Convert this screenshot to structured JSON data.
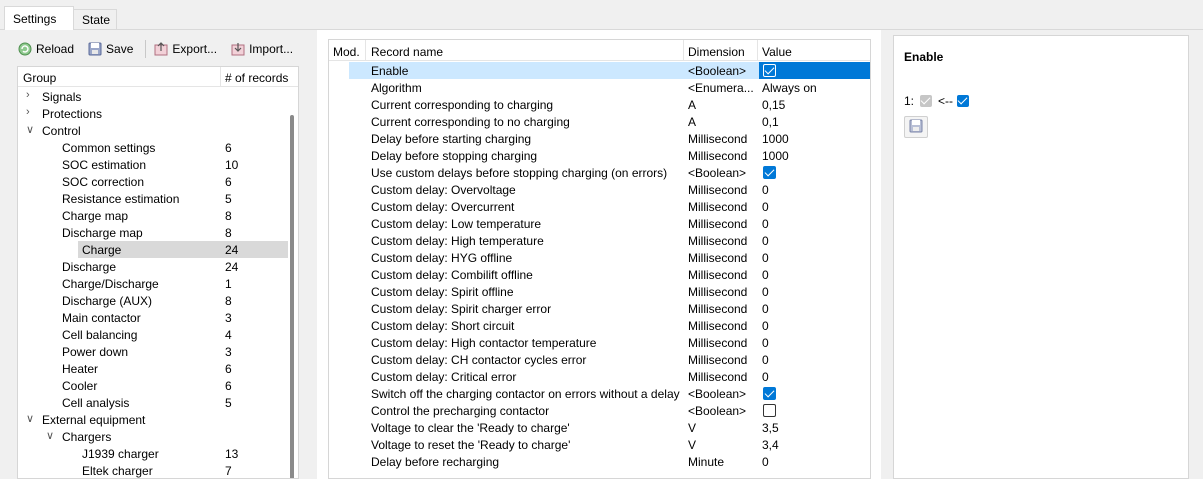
{
  "tabs": [
    {
      "label": "Settings"
    },
    {
      "label": "State"
    }
  ],
  "toolbar": {
    "reload": "Reload",
    "save": "Save",
    "export": "Export...",
    "import": "Import..."
  },
  "tree": {
    "headers": {
      "group": "Group",
      "count": "# of records"
    },
    "items": [
      {
        "label": "Signals",
        "count": "",
        "level": 0,
        "arrow": "collapsed"
      },
      {
        "label": "Protections",
        "count": "",
        "level": 0,
        "arrow": "collapsed"
      },
      {
        "label": "Control",
        "count": "",
        "level": 0,
        "arrow": "expanded"
      },
      {
        "label": "Common settings",
        "count": "6",
        "level": 1,
        "arrow": ""
      },
      {
        "label": "SOC estimation",
        "count": "10",
        "level": 1,
        "arrow": ""
      },
      {
        "label": "SOC correction",
        "count": "6",
        "level": 1,
        "arrow": ""
      },
      {
        "label": "Resistance estimation",
        "count": "5",
        "level": 1,
        "arrow": ""
      },
      {
        "label": "Charge map",
        "count": "8",
        "level": 1,
        "arrow": ""
      },
      {
        "label": "Discharge map",
        "count": "8",
        "level": 1,
        "arrow": ""
      },
      {
        "label": "Charge",
        "count": "24",
        "level": 1,
        "arrow": "",
        "selected": true
      },
      {
        "label": "Discharge",
        "count": "24",
        "level": 1,
        "arrow": ""
      },
      {
        "label": "Charge/Discharge",
        "count": "1",
        "level": 1,
        "arrow": ""
      },
      {
        "label": "Discharge (AUX)",
        "count": "8",
        "level": 1,
        "arrow": ""
      },
      {
        "label": "Main contactor",
        "count": "3",
        "level": 1,
        "arrow": ""
      },
      {
        "label": "Cell balancing",
        "count": "4",
        "level": 1,
        "arrow": ""
      },
      {
        "label": "Power down",
        "count": "3",
        "level": 1,
        "arrow": ""
      },
      {
        "label": "Heater",
        "count": "6",
        "level": 1,
        "arrow": ""
      },
      {
        "label": "Cooler",
        "count": "6",
        "level": 1,
        "arrow": ""
      },
      {
        "label": "Cell analysis",
        "count": "5",
        "level": 1,
        "arrow": ""
      },
      {
        "label": "External equipment",
        "count": "",
        "level": 0,
        "arrow": "expanded"
      },
      {
        "label": "Chargers",
        "count": "",
        "level": 1,
        "arrow": "expanded"
      },
      {
        "label": "J1939 charger",
        "count": "13",
        "level": 2,
        "arrow": ""
      },
      {
        "label": "Eltek charger",
        "count": "7",
        "level": 2,
        "arrow": ""
      }
    ]
  },
  "grid": {
    "headers": {
      "mod": "Mod.",
      "name": "Record name",
      "dim": "Dimension",
      "value": "Value"
    },
    "rows": [
      {
        "name": "Enable",
        "dim": "<Boolean>",
        "value": "",
        "check": "on",
        "selected": true
      },
      {
        "name": "Algorithm",
        "dim": "<Enumera...",
        "value": "Always on"
      },
      {
        "name": "Current corresponding to charging",
        "dim": "A",
        "value": "0,15"
      },
      {
        "name": "Current corresponding to no charging",
        "dim": "A",
        "value": "0,1"
      },
      {
        "name": "Delay before starting charging",
        "dim": "Millisecond",
        "value": "1000"
      },
      {
        "name": "Delay before stopping charging",
        "dim": "Millisecond",
        "value": "1000"
      },
      {
        "name": "Use custom delays before stopping charging (on errors)",
        "dim": "<Boolean>",
        "value": "",
        "check": "on"
      },
      {
        "name": "Custom delay: Overvoltage",
        "dim": "Millisecond",
        "value": "0"
      },
      {
        "name": "Custom delay: Overcurrent",
        "dim": "Millisecond",
        "value": "0"
      },
      {
        "name": "Custom delay: Low temperature",
        "dim": "Millisecond",
        "value": "0"
      },
      {
        "name": "Custom delay: High temperature",
        "dim": "Millisecond",
        "value": "0"
      },
      {
        "name": "Custom delay: HYG offline",
        "dim": "Millisecond",
        "value": "0"
      },
      {
        "name": "Custom delay: Combilift offline",
        "dim": "Millisecond",
        "value": "0"
      },
      {
        "name": "Custom delay: Spirit offline",
        "dim": "Millisecond",
        "value": "0"
      },
      {
        "name": "Custom delay: Spirit charger error",
        "dim": "Millisecond",
        "value": "0"
      },
      {
        "name": "Custom delay: Short circuit",
        "dim": "Millisecond",
        "value": "0"
      },
      {
        "name": "Custom delay: High contactor temperature",
        "dim": "Millisecond",
        "value": "0"
      },
      {
        "name": "Custom delay: CH contactor cycles error",
        "dim": "Millisecond",
        "value": "0"
      },
      {
        "name": "Custom delay: Critical error",
        "dim": "Millisecond",
        "value": "0"
      },
      {
        "name": "Switch off the charging contactor on errors without a delay",
        "dim": "<Boolean>",
        "value": "",
        "check": "on"
      },
      {
        "name": "Control the precharging contactor",
        "dim": "<Boolean>",
        "value": "",
        "check": "off"
      },
      {
        "name": "Voltage to clear the 'Ready to charge'",
        "dim": "V",
        "value": "3,5"
      },
      {
        "name": "Voltage to reset the 'Ready to charge'",
        "dim": "V",
        "value": "3,4"
      },
      {
        "name": "Delay before recharging",
        "dim": "Minute",
        "value": "0"
      }
    ]
  },
  "panel": {
    "title": "Enable",
    "index": "1:",
    "arrow": "<--"
  },
  "colors": {
    "accent": "#0078d7",
    "selection": "#cce8ff",
    "tree_selection": "#d9d9d9"
  }
}
